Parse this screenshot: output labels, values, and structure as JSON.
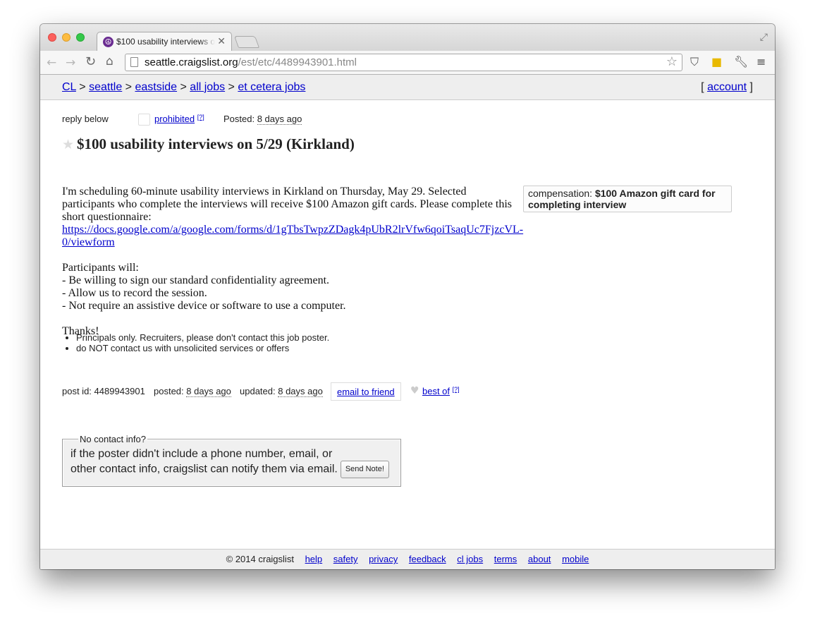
{
  "browser": {
    "tab_title": "$100 usability interviews o",
    "url_host": "seattle.craigslist.org",
    "url_path": "/est/etc/4489943901.html"
  },
  "breadcrumbs": [
    "CL",
    "seattle",
    "eastside",
    "all jobs",
    "et cetera jobs"
  ],
  "account_label": "account",
  "postinfo_top": {
    "reply": "reply below",
    "prohibited": "prohibited",
    "help_mark": "[?]",
    "posted_label": "Posted:",
    "posted_value": "8 days ago"
  },
  "title": "$100 usability interviews on 5/29 (Kirkland)",
  "compensation": {
    "label": "compensation:",
    "value": "$100 Amazon gift card for completing interview"
  },
  "body": {
    "intro": "I'm scheduling 60-minute usability interviews in Kirkland on Thursday, May 29. Selected participants who complete the interviews will receive $100 Amazon gift cards. Please complete this short questionnaire:",
    "link": "https://docs.google.com/a/google.com/forms/d/1gTbsTwpzZDagk4pUbR2lrVfw6qoiTsaqUc7FjzcVL-0/viewform",
    "participants_heading": "Participants will:",
    "requirements": [
      "- Be willing to sign our standard confidentiality agreement.",
      "- Allow us to record the session.",
      "- Not require an assistive device or software to use a computer."
    ],
    "thanks": "Thanks!"
  },
  "notices": [
    "Principals only. Recruiters, please don't contact this job poster.",
    "do NOT contact us with unsolicited services or offers"
  ],
  "postinfo_bottom": {
    "post_id_label": "post id:",
    "post_id": "4489943901",
    "posted_label": "posted:",
    "posted_value": "8 days ago",
    "updated_label": "updated:",
    "updated_value": "8 days ago",
    "email_friend": "email to friend",
    "best_of": "best of",
    "help_mark": "[?]"
  },
  "no_contact": {
    "legend": "No contact info?",
    "line1": "if the poster didn't include a phone number, email, or",
    "line2": "other contact info, craigslist can notify them via email.",
    "button": "Send Note!"
  },
  "footer": {
    "copyright": "© 2014 craigslist",
    "links": [
      "help",
      "safety",
      "privacy",
      "feedback",
      "cl jobs",
      "terms",
      "about",
      "mobile"
    ]
  }
}
